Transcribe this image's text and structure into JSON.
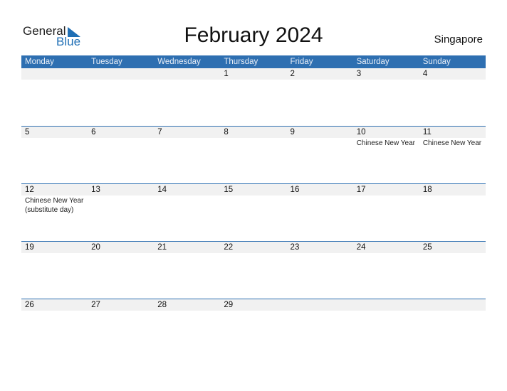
{
  "logo": {
    "general": "General",
    "blue": "Blue"
  },
  "title": "February 2024",
  "country": "Singapore",
  "weekdays": [
    "Monday",
    "Tuesday",
    "Wednesday",
    "Thursday",
    "Friday",
    "Saturday",
    "Sunday"
  ],
  "weeks": [
    [
      {
        "d": ""
      },
      {
        "d": ""
      },
      {
        "d": ""
      },
      {
        "d": "1"
      },
      {
        "d": "2"
      },
      {
        "d": "3"
      },
      {
        "d": "4"
      }
    ],
    [
      {
        "d": "5"
      },
      {
        "d": "6"
      },
      {
        "d": "7"
      },
      {
        "d": "8"
      },
      {
        "d": "9"
      },
      {
        "d": "10",
        "h": "Chinese New Year"
      },
      {
        "d": "11",
        "h": "Chinese New Year"
      }
    ],
    [
      {
        "d": "12",
        "h": "Chinese New Year (substitute day)"
      },
      {
        "d": "13"
      },
      {
        "d": "14"
      },
      {
        "d": "15"
      },
      {
        "d": "16"
      },
      {
        "d": "17"
      },
      {
        "d": "18"
      }
    ],
    [
      {
        "d": "19"
      },
      {
        "d": "20"
      },
      {
        "d": "21"
      },
      {
        "d": "22"
      },
      {
        "d": "23"
      },
      {
        "d": "24"
      },
      {
        "d": "25"
      }
    ],
    [
      {
        "d": "26"
      },
      {
        "d": "27"
      },
      {
        "d": "28"
      },
      {
        "d": "29"
      },
      {
        "d": ""
      },
      {
        "d": ""
      },
      {
        "d": ""
      }
    ]
  ]
}
